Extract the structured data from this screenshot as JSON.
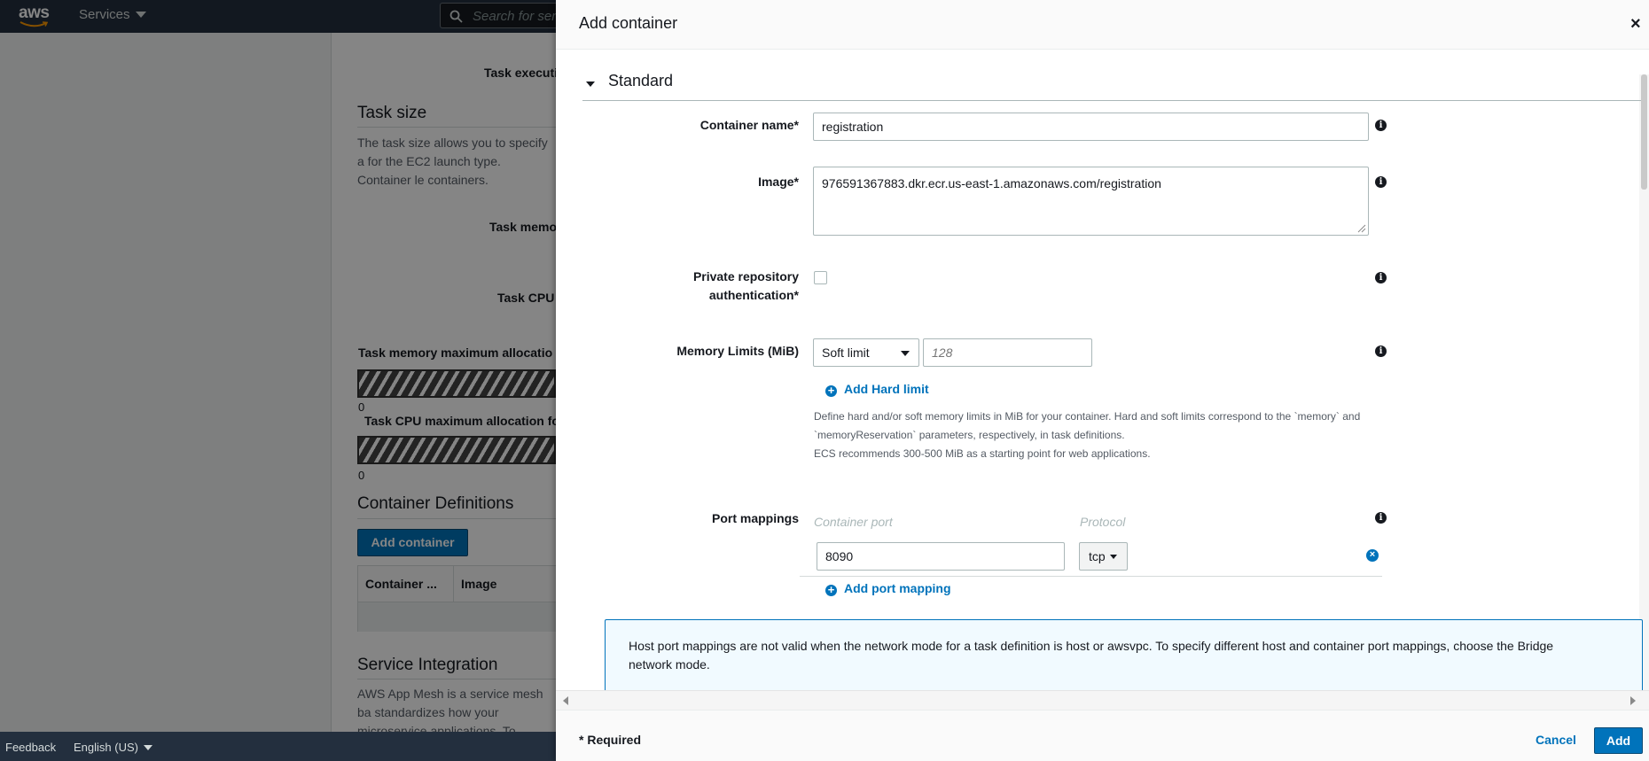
{
  "nav": {
    "logo_text": "aws",
    "services_label": "Services",
    "search_placeholder": "Search for servi"
  },
  "background_page": {
    "task_execution_label": "Task executi",
    "task_size_title": "Task size",
    "task_size_description": "The task size allows you to specify a for the EC2 launch type. Container le containers.",
    "task_memory_label": "Task memo",
    "task_cpu_label": "Task CPU",
    "memory_alloc_label": "Task memory maximum allocatio",
    "memory_alloc_value": "0",
    "cpu_alloc_label": "Task CPU maximum allocation fo",
    "cpu_alloc_value": "0",
    "container_defs_title": "Container Definitions",
    "add_container_button": "Add container",
    "table_headers": [
      "Container ...",
      "Image"
    ],
    "service_integration_title": "Service Integration",
    "service_integration_text": "AWS App Mesh is a service mesh ba standardizes how your microservice applications. To enable App Mesh in"
  },
  "footer": {
    "feedback": "Feedback",
    "language": "English (US)"
  },
  "modal": {
    "title": "Add container",
    "close": "×",
    "section_title": "Standard",
    "container_name": {
      "label": "Container name*",
      "value": "registration"
    },
    "image": {
      "label": "Image*",
      "value": "976591367883.dkr.ecr.us-east-1.amazonaws.com/registration"
    },
    "private_repo": {
      "label_line1": "Private repository",
      "label_line2": "authentication*",
      "checked": false
    },
    "memory_limits": {
      "label": "Memory Limits (MiB)",
      "type": "Soft limit",
      "placeholder": "128",
      "add_hard_limit": "Add Hard limit",
      "help_lines": [
        "Define hard and/or soft memory limits in MiB for your container. Hard and soft limits correspond to the `memory` and",
        "`memoryReservation` parameters, respectively, in task definitions.",
        "ECS recommends 300-500 MiB as a starting point for web applications."
      ]
    },
    "port_mappings": {
      "label": "Port mappings",
      "container_port_header": "Container port",
      "protocol_header": "Protocol",
      "rows": [
        {
          "container_port": "8090",
          "protocol": "tcp"
        }
      ],
      "add_port_mapping": "Add port mapping"
    },
    "alert_text": "Host port mappings are not valid when the network mode for a task definition is host or awsvpc. To specify different host and container port mappings, choose the Bridge network mode.",
    "required_note": "* Required",
    "cancel": "Cancel",
    "add": "Add"
  }
}
